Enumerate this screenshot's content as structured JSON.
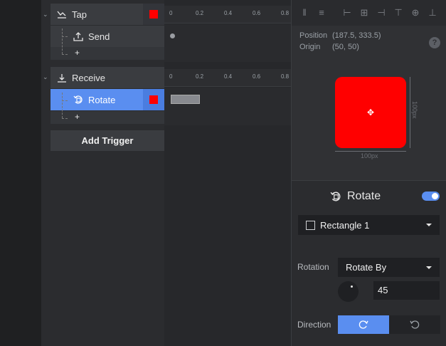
{
  "tracks": {
    "tap_label": "Tap",
    "send_label": "Send",
    "receive_label": "Receive",
    "rotate_label": "Rotate",
    "add_symbol": "+",
    "add_trigger_label": "Add Trigger",
    "swatch_color": "#ff0000",
    "selected_color": "#5a8ef0"
  },
  "timeline": {
    "ticks": [
      "0",
      "0.2",
      "0.4",
      "0.6",
      "0.8"
    ]
  },
  "inspector": {
    "position_label": "Position",
    "position_value": "(187.5, 333.5)",
    "origin_label": "Origin",
    "origin_value": "(50, 50)",
    "help_symbol": "?",
    "width_label": "100px",
    "height_label": "100px",
    "layer_color": "#ff0000",
    "animation_title": "Rotate",
    "animation_enabled": true,
    "target_layer": "Rectangle 1",
    "rotation_label": "Rotation",
    "rotation_mode": "Rotate By",
    "rotation_value": "45",
    "direction_label": "Direction",
    "direction_selected": "clockwise"
  }
}
